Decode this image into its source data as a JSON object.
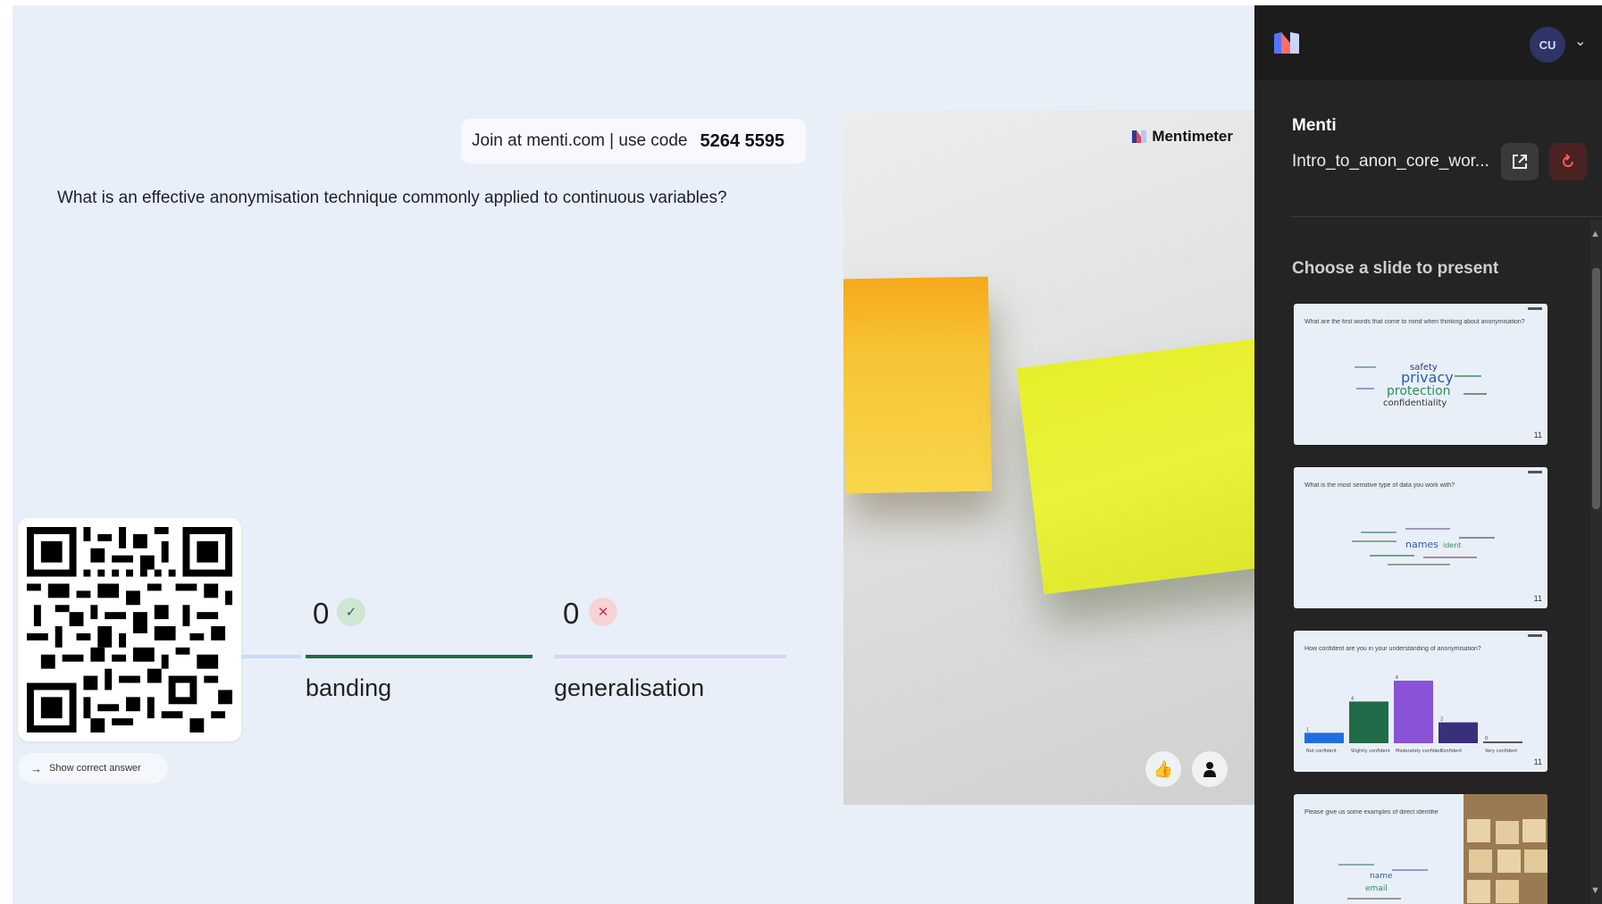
{
  "join": {
    "text": "Join at menti.com | use code",
    "code": "5264 5595"
  },
  "question": "What is an effective anonymisation technique commonly applied to continuous variables?",
  "show_answer_label": "Show correct answer",
  "options": [
    {
      "label": "banding",
      "count": "0",
      "correct": true
    },
    {
      "label": "generalisation",
      "count": "0",
      "correct": false
    }
  ],
  "image_brand": "Mentimeter",
  "sidebar": {
    "avatar_initials": "CU",
    "title": "Menti",
    "file_name": "Intro_to_anon_core_wor...",
    "choose_label": "Choose a slide to present",
    "thumbnails": [
      {
        "question": "What are the first words that come to mind when thinking about anonymisation?",
        "count": "11"
      },
      {
        "question": "What is the most sensitive type of data you work with?",
        "count": "11"
      },
      {
        "question": "How confident are you in your understanding of anonymisation?",
        "count": "11"
      },
      {
        "question": "Please give us some examples of direct identifiers",
        "count": ""
      }
    ],
    "thumb3_bars": [
      {
        "value": 1,
        "label": "Not confident",
        "color": "#1f6fe0"
      },
      {
        "value": 4,
        "label": "Slightly confident",
        "color": "#216b48"
      },
      {
        "value": 6,
        "label": "Moderately confident",
        "color": "#8a52d6"
      },
      {
        "value": 2,
        "label": "Confident",
        "color": "#3a2f7a"
      },
      {
        "value": 0,
        "label": "Very confident",
        "color": "#555555"
      }
    ]
  },
  "colors": {
    "stage_bg": "#e9eff9",
    "correct_green": "#216b48",
    "sidebar_bg": "#242424"
  }
}
